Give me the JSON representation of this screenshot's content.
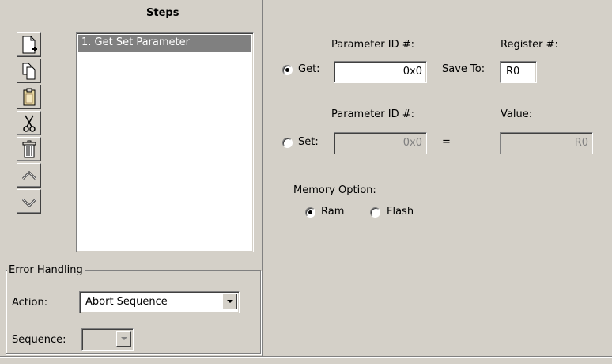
{
  "steps": {
    "title": "Steps",
    "list": [
      "1. Get Set Parameter"
    ],
    "toolbar": [
      {
        "icon": "new-step-icon"
      },
      {
        "icon": "copy-icon"
      },
      {
        "icon": "paste-icon"
      },
      {
        "icon": "cut-icon"
      },
      {
        "icon": "delete-icon"
      },
      {
        "icon": "move-up-icon"
      },
      {
        "icon": "move-down-icon"
      }
    ]
  },
  "get": {
    "label": "Get:",
    "param_label": "Parameter ID #:",
    "param_value": "0x0",
    "save_to_label": "Save To:",
    "register_label": "Register #:",
    "register_value": "R0"
  },
  "set": {
    "label": "Set:",
    "param_label": "Parameter ID #:",
    "param_value": "0x0",
    "equals": "=",
    "value_label": "Value:",
    "value": "R0"
  },
  "memory": {
    "label": "Memory Option:",
    "ram": "Ram",
    "flash": "Flash"
  },
  "error_handling": {
    "legend": "Error Handling",
    "action_label": "Action:",
    "action_value": "Abort Sequence",
    "sequence_label": "Sequence:",
    "sequence_value": ""
  }
}
